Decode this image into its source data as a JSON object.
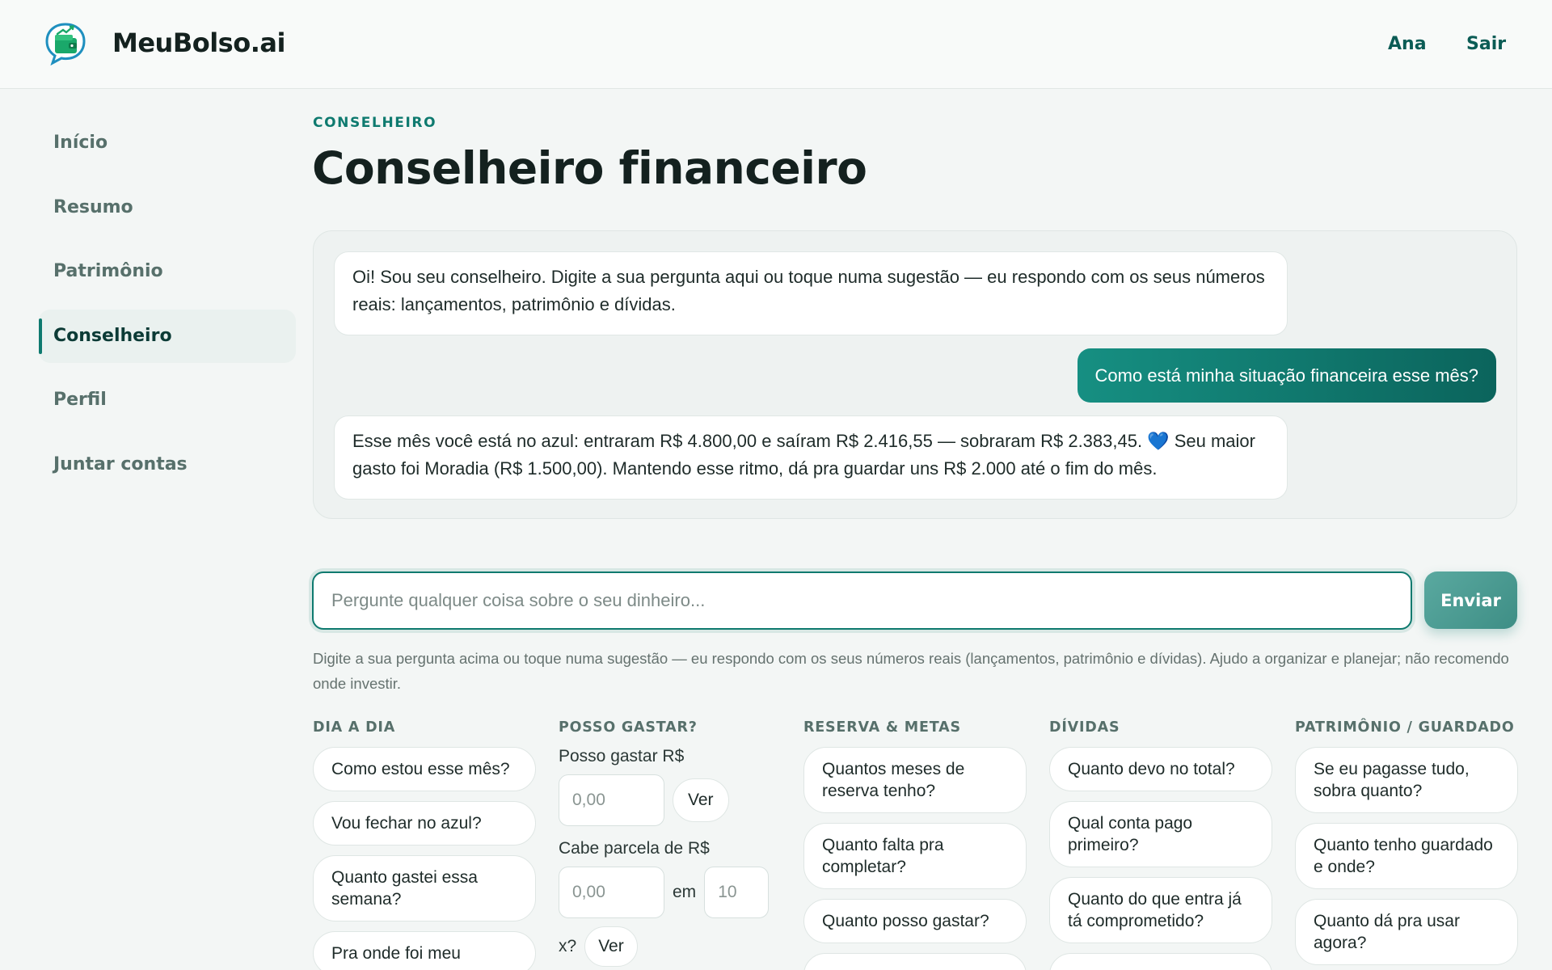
{
  "header": {
    "brand": "MeuBolso.ai",
    "user_name": "Ana",
    "logout_label": "Sair"
  },
  "sidebar": {
    "items": [
      {
        "label": "Início",
        "active": false
      },
      {
        "label": "Resumo",
        "active": false
      },
      {
        "label": "Patrimônio",
        "active": false
      },
      {
        "label": "Conselheiro",
        "active": true
      },
      {
        "label": "Perfil",
        "active": false
      },
      {
        "label": "Juntar contas",
        "active": false
      }
    ]
  },
  "page": {
    "eyebrow": "CONSELHEIRO",
    "title": "Conselheiro financeiro"
  },
  "chat": {
    "messages": [
      {
        "role": "assistant",
        "text": "Oi! Sou seu conselheiro. Digite a sua pergunta aqui ou toque numa sugestão — eu respondo com os seus números reais: lançamentos, patrimônio e dívidas."
      },
      {
        "role": "user",
        "text": "Como está minha situação financeira esse mês?"
      },
      {
        "role": "assistant",
        "text_before": "Esse mês você está no azul: entraram R$ 4.800,00 e saíram R$ 2.416,55 — sobraram R$ 2.383,45.",
        "emoji": "💙",
        "text_after": " Seu maior gasto foi Moradia (R$ 1.500,00). Mantendo esse ritmo, dá pra guardar uns R$ 2.000 até o fim do mês."
      }
    ]
  },
  "input": {
    "placeholder": "Pergunte qualquer coisa sobre o seu dinheiro...",
    "value": "",
    "send_label": "Enviar"
  },
  "hint": "Digite a sua pergunta acima ou toque numa sugestão — eu respondo com os seus números reais (lançamentos, patrimônio e dívidas). Ajudo a organizar e planejar; não recomendo onde investir.",
  "suggestions": {
    "dia_a_dia": {
      "title": "DIA A DIA",
      "items": [
        "Como estou esse mês?",
        "Vou fechar no azul?",
        "Quanto gastei essa semana?",
        "Pra onde foi meu"
      ]
    },
    "posso_gastar": {
      "title": "POSSO GASTAR?",
      "spend_label": "Posso gastar R$",
      "spend_placeholder": "0,00",
      "ver_label": "Ver",
      "installment_label": "Cabe parcela de R$",
      "installment_placeholder": "0,00",
      "em_label": "em",
      "months_placeholder": "10",
      "x_label": "x?"
    },
    "reserva": {
      "title": "RESERVA & METAS",
      "items": [
        "Quantos meses de reserva tenho?",
        "Quanto falta pra completar?",
        "Quanto posso gastar?"
      ]
    },
    "dividas": {
      "title": "DÍVIDAS",
      "items": [
        "Quanto devo no total?",
        "Qual conta pago primeiro?",
        "Quanto do que entra já tá comprometido?"
      ]
    },
    "patrimonio": {
      "title": "PATRIMÔNIO / GUARDADO",
      "items": [
        "Se eu pagasse tudo, sobra quanto?",
        "Quanto tenho guardado e onde?",
        "Quanto dá pra usar agora?"
      ]
    }
  },
  "colors": {
    "accent": "#0e7a6f",
    "background": "#f3f6f5"
  }
}
